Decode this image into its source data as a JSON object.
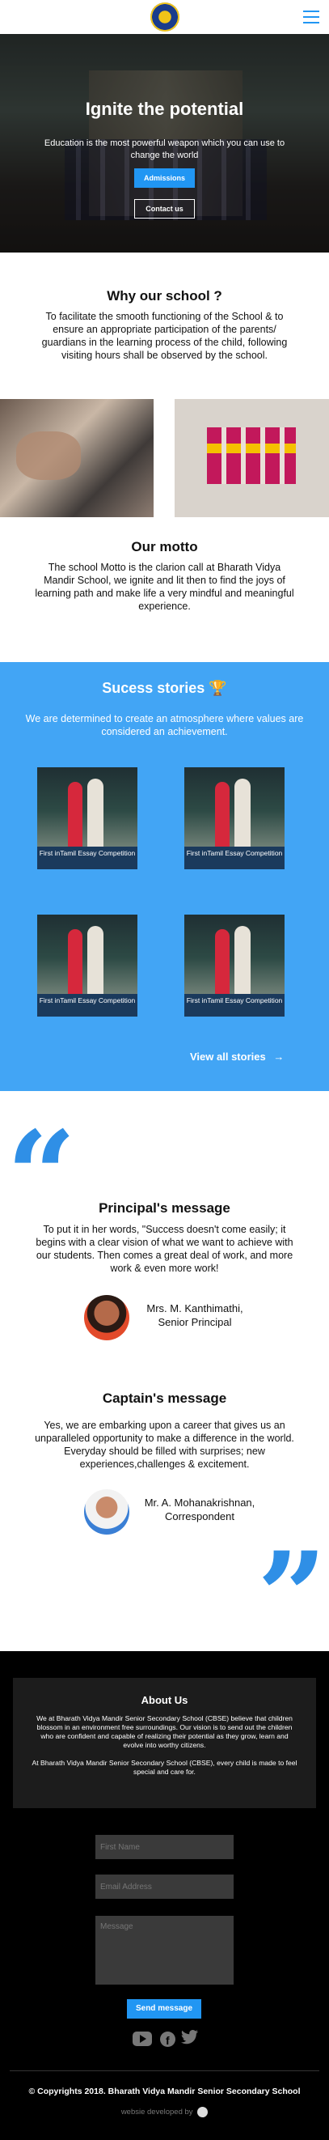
{
  "header": {
    "logo_icon": "school-emblem-icon",
    "menu_icon": "hamburger-menu-icon"
  },
  "hero": {
    "title": "Ignite the potential",
    "subtitle": "Education is the most powerful weapon  which you can use to change the world",
    "admissions_label": "Admissions",
    "contact_label": "Contact us"
  },
  "why": {
    "title": "Why our school ?",
    "text": "To facilitate the smooth functioning of the School & to ensure an appropriate participation of the parents/ guardians in the learning process of the child, following visiting hours shall be observed by the school."
  },
  "motto": {
    "title": "Our motto",
    "text": "The school Motto  is the clarion call at Bharath Vidya Mandir School, we ignite and lit then to find the joys of learning path and make life a very mindful and meaningful experience."
  },
  "success": {
    "title": "Sucess stories",
    "trophy_icon": "trophy-icon",
    "text": "We are determined to create an atmosphere where values are considered an achievement.",
    "cards": [
      {
        "caption": "First inTamil Essay Competition"
      },
      {
        "caption": "First inTamil Essay Competition"
      },
      {
        "caption": "First inTamil Essay Competition"
      },
      {
        "caption": "First inTamil Essay Competition"
      }
    ],
    "view_all_label": "View all stories"
  },
  "principal": {
    "title": "Principal's message",
    "text": "To put it in her words, \"Success doesn't come easily; it begins with a clear vision of what we want to achieve with our students. Then comes a great deal of work, and more work & even more work!",
    "name": "Mrs. M. Kanthimathi,",
    "role": "Senior Principal"
  },
  "captain": {
    "title": "Captain's message",
    "text": "Yes, we are embarking upon a career that gives us an unparalleled opportunity to make a difference in the world. Everyday should be filled with surprises; new experiences,challenges & excitement.",
    "name": "Mr. A. Mohanakrishnan,",
    "role": "Correspondent"
  },
  "about": {
    "title": "About Us",
    "p1": "We at Bharath Vidya Mandir Senior Secondary School (CBSE) believe that children blossom in an environment free surroundings. Our vision is to send out the children who are confident and capable of realizing their potential as they grow, learn and evolve into worthy citizens.",
    "p2": "At Bharath Vidya Mandir Senior Secondary School (CBSE), every child is made to feel special and care for."
  },
  "form": {
    "first_name_placeholder": "First Name",
    "email_placeholder": "Email Address",
    "message_placeholder": "Message",
    "send_label": "Send message"
  },
  "social": {
    "youtube_icon": "youtube-icon",
    "facebook_icon": "facebook-icon",
    "twitter_icon": "twitter-icon"
  },
  "footer": {
    "copyright": "© Copyrights 2018. Bharath Vidya Mandir Senior Secondary School",
    "developed_by": "websie developed by"
  },
  "colors": {
    "accent": "#2196f3",
    "success_bg": "#42a5f5",
    "quote": "#2f8fe6",
    "footer_bg": "#000000"
  }
}
